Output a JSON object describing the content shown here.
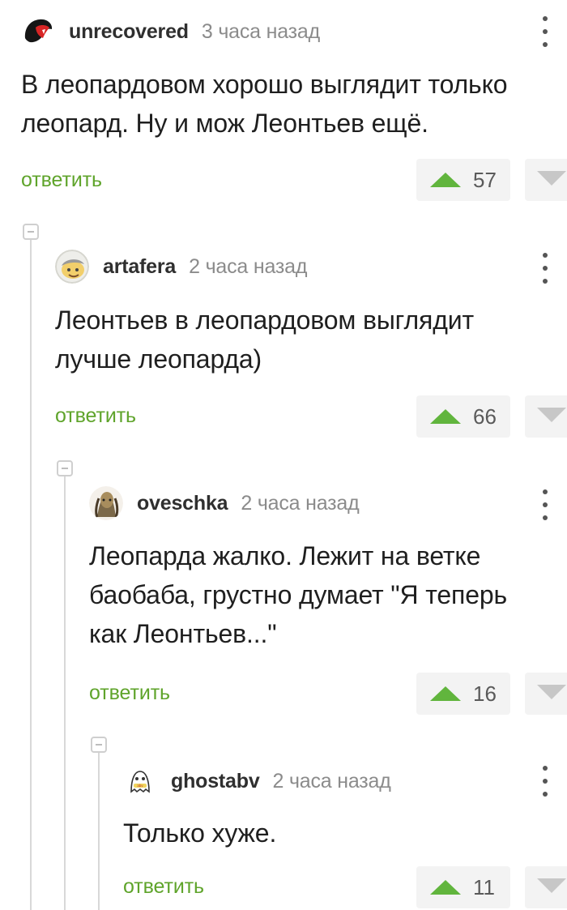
{
  "comments": [
    {
      "username": "unrecovered",
      "timestamp": "3 часа назад",
      "text": "В леопардовом хорошо выглядит только\nлеопард. Ну и мож Леонтьев ещё.",
      "reply_label": "ответить",
      "votes": "57",
      "avatar": "red-mouth-avatar"
    },
    {
      "username": "artafera",
      "timestamp": "2 часа назад",
      "text": "Леонтьев в леопардовом выглядит\nлучше леопарда)",
      "reply_label": "ответить",
      "votes": "66",
      "avatar": "cartoon-face-avatar"
    },
    {
      "username": "oveschka",
      "timestamp": "2 часа назад",
      "text": "Леопарда жалко. Лежит на ветке\nбаобаба, грустно думает \"Я теперь\nкак Леонтьев...\"",
      "reply_label": "ответить",
      "votes": "16",
      "avatar": "predator-avatar"
    },
    {
      "username": "ghostabv",
      "timestamp": "2 часа назад",
      "text": "Только хуже.",
      "reply_label": "ответить",
      "votes": "11",
      "avatar": "ghost-avatar"
    }
  ],
  "colors": {
    "reply_link": "#5fa42b",
    "vote_up": "#61b53d",
    "vote_down": "#c7c7c7",
    "timestamp": "#8b8b8b",
    "thread_line": "#d8d8d8"
  },
  "icons": {
    "more": "more-vertical-icon",
    "vote_up": "triangle-up-icon",
    "vote_down": "triangle-down-icon",
    "collapse": "collapse-minus-icon"
  }
}
